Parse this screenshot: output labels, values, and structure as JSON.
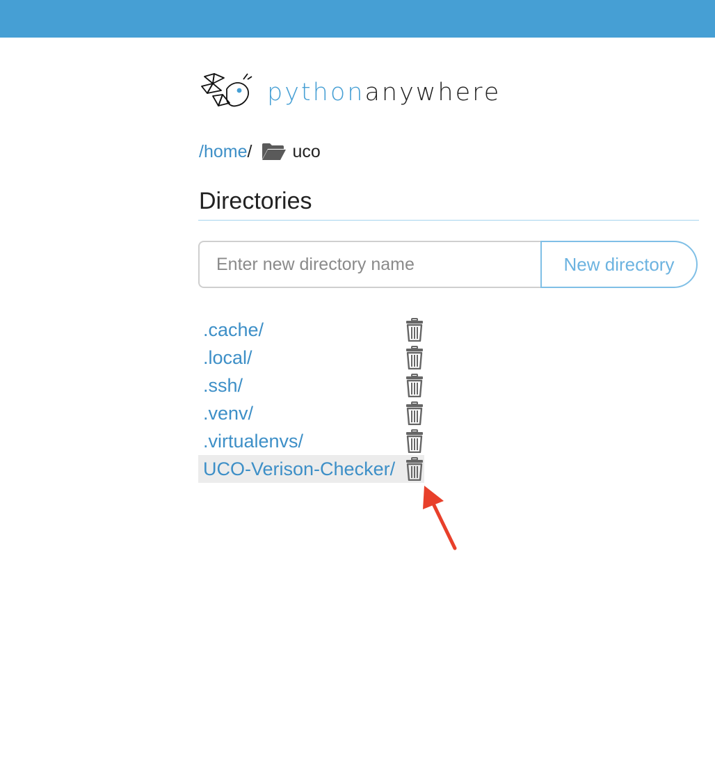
{
  "header": {
    "bar_color": "#469fd4"
  },
  "logo": {
    "part1": "python",
    "part2": "anywhere",
    "icon": "pythonanywhere-logo-icon"
  },
  "breadcrumb": {
    "home_link": "/home",
    "separator": "/",
    "folder_icon": "folder-open-icon",
    "current": "uco"
  },
  "directories": {
    "title": "Directories",
    "input_placeholder": "Enter new directory name",
    "new_button_label": "New directory",
    "items": [
      {
        "name": ".cache/"
      },
      {
        "name": ".local/"
      },
      {
        "name": ".ssh/"
      },
      {
        "name": ".venv/"
      },
      {
        "name": ".virtualenvs/"
      },
      {
        "name": "UCO-Verison-Checker/",
        "highlighted": true
      }
    ],
    "delete_icon": "trash-icon"
  },
  "annotation": {
    "icon": "red-arrow-icon",
    "color": "#e8402b"
  }
}
